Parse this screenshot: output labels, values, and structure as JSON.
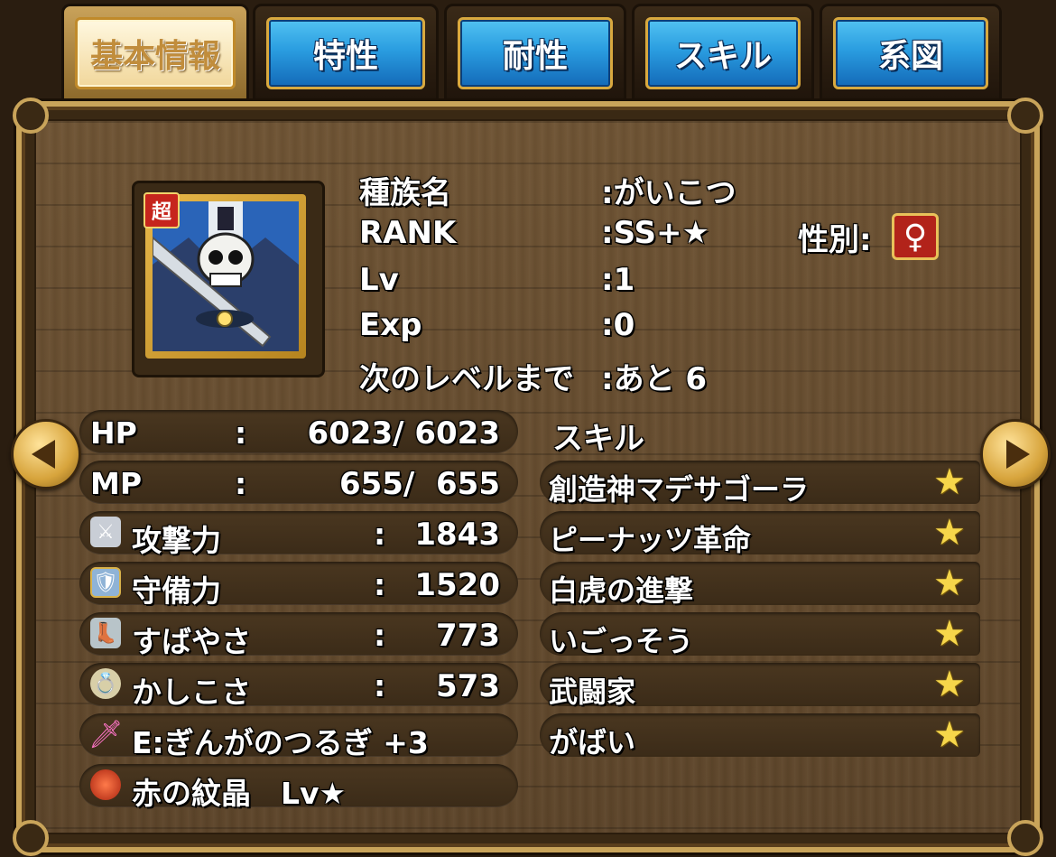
{
  "tabs": [
    {
      "label": "基本情報",
      "active": true
    },
    {
      "label": "特性",
      "active": false
    },
    {
      "label": "耐性",
      "active": false
    },
    {
      "label": "スキル",
      "active": false
    },
    {
      "label": "系図",
      "active": false
    }
  ],
  "portrait": {
    "badge": "超"
  },
  "info": {
    "species_label": "種族名",
    "species_value": ":がいこつ",
    "rank_label": "RANK",
    "rank_value": ":SS+★",
    "gender_label": "性別:",
    "gender_symbol": "♀",
    "lv_label": "Lv",
    "lv_value": ":1",
    "exp_label": "Exp",
    "exp_value": ":0",
    "next_label": "次のレベルまで",
    "next_value": ":あと 6"
  },
  "stats": {
    "hp_label": "HP",
    "hp_value": "6023/ 6023",
    "mp_label": "MP",
    "mp_value": "655/  655",
    "colon": ":",
    "attack_label": "攻撃力",
    "attack_value": "1843",
    "defense_label": "守備力",
    "defense_value": "1520",
    "speed_label": "すばやさ",
    "speed_value": "773",
    "wisdom_label": "かしこさ",
    "wisdom_value": "573",
    "equip": "E:ぎんがのつるぎ +3",
    "crest": "赤の紋晶　Lv★"
  },
  "skills": {
    "header": "スキル",
    "items": [
      "創造神マデサゴーラ",
      "ピーナッツ革命",
      "白虎の進撃",
      "いごっそう",
      "武闘家",
      "がばい"
    ],
    "star": "★"
  },
  "colors": {
    "accent_gold": "#c9a45a",
    "tab_blue": "#2a9de0",
    "star": "#f6d64a"
  },
  "icons": [
    "sword-icon",
    "shield-icon",
    "boot-icon",
    "ring-icon",
    "pink-sword-icon",
    "red-gem-icon",
    "arrow-left-icon",
    "arrow-right-icon"
  ]
}
